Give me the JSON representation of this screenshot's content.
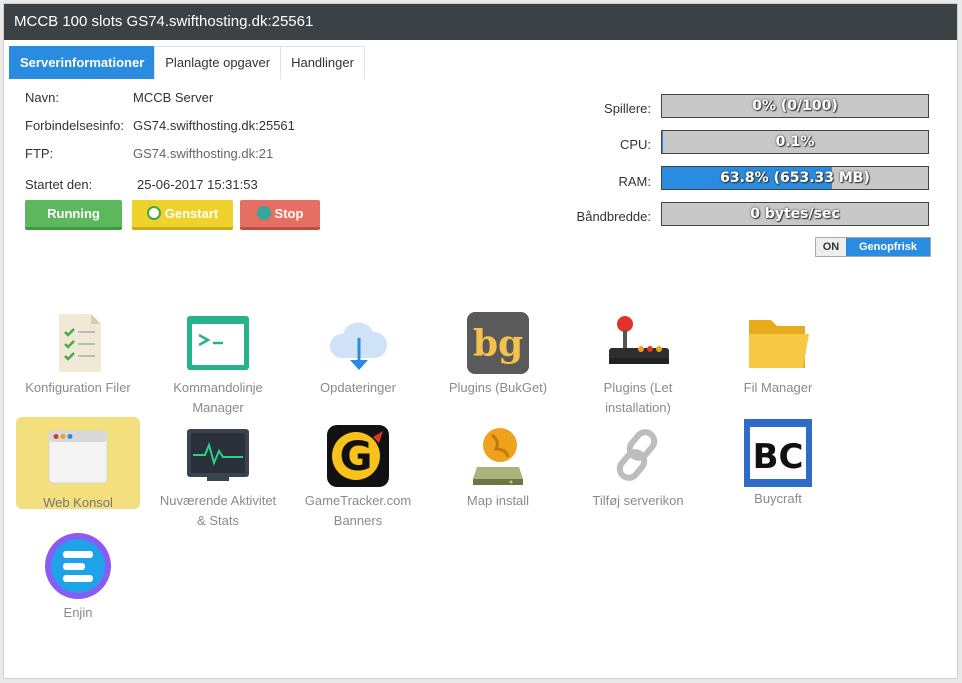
{
  "window": {
    "title": "MCCB 100 slots GS74.swifthosting.dk:25561"
  },
  "tabs": [
    {
      "label": "Serverinformationer",
      "active": true
    },
    {
      "label": "Planlagte opgaver",
      "active": false
    },
    {
      "label": "Handlinger",
      "active": false
    }
  ],
  "info": {
    "name_label": "Navn:",
    "name_value": "MCCB Server",
    "conn_label": "Forbindelsesinfo:",
    "conn_value": "GS74.swifthosting.dk:25561",
    "ftp_label": "FTP:",
    "ftp_value": "GS74.swifthosting.dk:21",
    "started_label": "Startet den:",
    "started_value": "25-06-2017 15:31:53"
  },
  "buttons": {
    "running": "Running",
    "restart": "Genstart",
    "stop": "Stop"
  },
  "stats": {
    "players_label": "Spillere:",
    "players_text": "0% (0/100)",
    "players_fraction": 0,
    "cpu_label": "CPU:",
    "cpu_text": "0.1%",
    "cpu_fraction": 0.001,
    "ram_label": "RAM:",
    "ram_text": "63.8% (653.33 MB)",
    "ram_fraction": 0.638,
    "bw_label": "Båndbredde:",
    "bw_text": "0 bytes/sec",
    "bw_fraction": 0
  },
  "refresh": {
    "state": "ON",
    "label": "Genopfrisk"
  },
  "tools": [
    {
      "label": "Konfiguration Filer",
      "icon": "config-files-icon"
    },
    {
      "label": "Kommandolinje Manager",
      "icon": "terminal-icon"
    },
    {
      "label": "Opdateringer",
      "icon": "cloud-download-icon"
    },
    {
      "label": "Plugins (BukGet)",
      "icon": "bukget-icon"
    },
    {
      "label": "Plugins (Let installation)",
      "icon": "joystick-icon"
    },
    {
      "label": "Fil Manager",
      "icon": "folder-icon"
    },
    {
      "label": "Web Konsol",
      "icon": "browser-window-icon"
    },
    {
      "label": "Nuværende Aktivitet & Stats",
      "icon": "activity-monitor-icon"
    },
    {
      "label": "GameTracker.com Banners",
      "icon": "gametracker-icon"
    },
    {
      "label": "Map install",
      "icon": "map-install-icon"
    },
    {
      "label": "Tilføj serverikon",
      "icon": "chain-link-icon"
    },
    {
      "label": "Buycraft",
      "icon": "buycraft-icon"
    },
    {
      "label": "Enjin",
      "icon": "enjin-icon"
    }
  ],
  "icon_texts": {
    "bukget": "bg",
    "gametracker": "G",
    "buycraft": "BC"
  },
  "colors": {
    "accent": "#2a8ce0",
    "running": "#5cb85c",
    "restart": "#f0d22c",
    "stop": "#e56f62",
    "titlebar": "#3c4146"
  }
}
